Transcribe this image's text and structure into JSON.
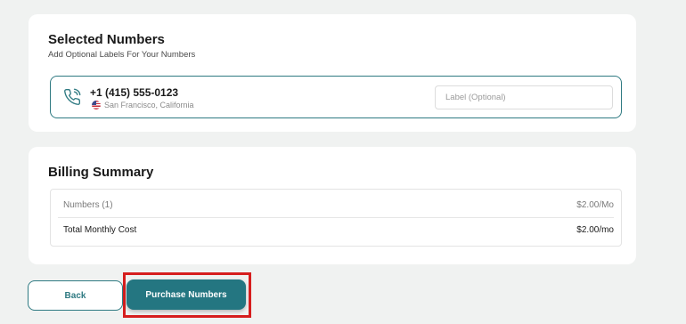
{
  "selected_numbers": {
    "title": "Selected Numbers",
    "subtitle": "Add Optional Labels For Your Numbers",
    "items": [
      {
        "phone_number": "+1 (415) 555-0123",
        "location": "San Francisco, California",
        "flag_icon": "us-flag-icon",
        "label_placeholder": "Label (Optional)",
        "label_value": ""
      }
    ]
  },
  "billing_summary": {
    "title": "Billing Summary",
    "rows": [
      {
        "label": "Numbers (1)",
        "amount": "$2.00/Mo"
      },
      {
        "label": "Total Monthly Cost",
        "amount": "$2.00/mo"
      }
    ]
  },
  "actions": {
    "back_label": "Back",
    "purchase_label": "Purchase Numbers"
  },
  "colors": {
    "accent": "#247681",
    "highlight": "#d61e1e",
    "background": "#f0f2f1"
  },
  "icons": {
    "phone": "phone-icon"
  }
}
